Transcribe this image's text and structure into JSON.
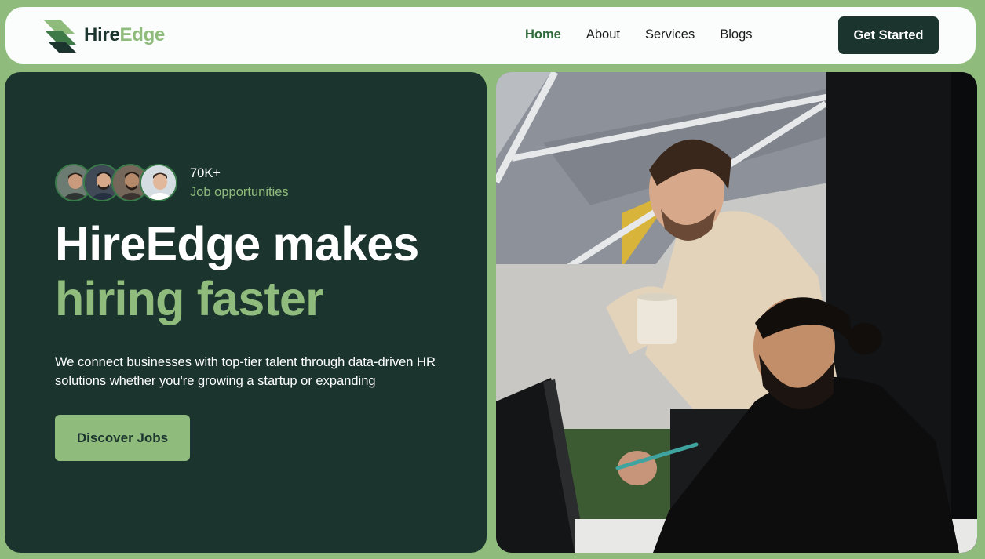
{
  "brand": {
    "name_part1": "Hire",
    "name_part2": "Edge"
  },
  "nav": {
    "links": [
      "Home",
      "About",
      "Services",
      "Blogs"
    ],
    "active": "Home",
    "cta_label": "Get Started"
  },
  "hero": {
    "stat_value": "70K+",
    "stat_label": "Job opportunities",
    "headline_line1": "HireEdge makes",
    "headline_line2": "hiring faster",
    "description": "We connect businesses with top-tier talent through data-driven HR solutions whether you're growing a startup or expanding",
    "cta_label": "Discover Jobs"
  },
  "colors": {
    "page_bg": "#8fbb7c",
    "dark_green": "#1b342d",
    "accent_green": "#8fbb7c",
    "nav_active": "#2f6b3a"
  }
}
